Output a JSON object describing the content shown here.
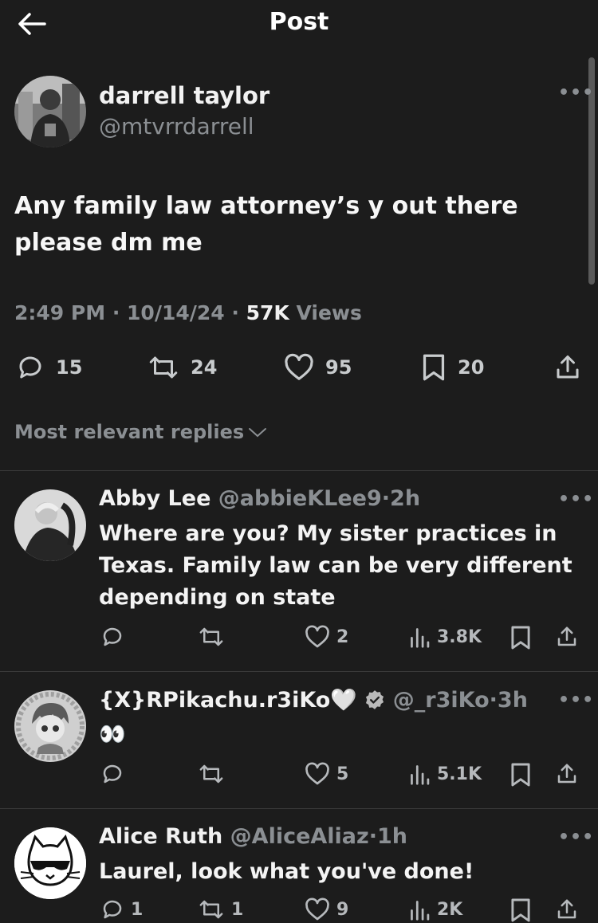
{
  "header": {
    "title": "Post"
  },
  "post": {
    "author_name": "darrell taylor",
    "author_handle": "@mtvrrdarrell",
    "text_line1": "Any family law attorney’s y out there",
    "text_line2": "please dm me",
    "time": "2:49 PM",
    "date": "10/14/24",
    "views_count": "57K",
    "views_label": "Views",
    "separator": "·",
    "stats": {
      "replies": "15",
      "reposts": "24",
      "likes": "95",
      "bookmarks": "20"
    }
  },
  "sort_label": "Most relevant replies",
  "replies": [
    {
      "name": "Abby Lee",
      "handle": "@abbieKLee9",
      "time": "2h",
      "text": "Where are you? My sister practices in Texas. Family law can be very different depending on state",
      "replies": "",
      "reposts": "",
      "likes": "2",
      "views": "3.8K"
    },
    {
      "name": "{X}RPikachu.r3iKo",
      "emoji": "🤍",
      "handle": "@_r3iKo",
      "time": "3h",
      "text": "👀",
      "replies": "",
      "reposts": "",
      "likes": "5",
      "views": "5.1K"
    },
    {
      "name": "Alice Ruth",
      "handle": "@AliceAliaz",
      "time": "1h",
      "text": "Laurel, look what you've done!",
      "replies": "1",
      "reposts": "1",
      "likes": "9",
      "views": "2K"
    }
  ],
  "colors": {
    "background": "#1c1c1c",
    "text": "#e7e9ea",
    "muted": "#8b8f93",
    "divider": "#3a3a3a"
  },
  "icons": [
    "back-arrow-icon",
    "more-icon",
    "reply-icon",
    "repost-icon",
    "like-icon",
    "bookmark-icon",
    "share-icon",
    "chevron-down-icon",
    "views-icon",
    "verified-icon"
  ]
}
